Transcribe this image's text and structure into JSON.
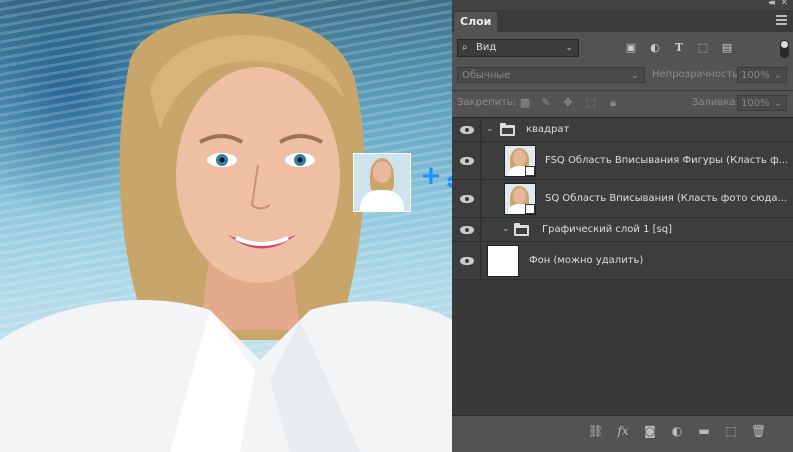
{
  "panel": {
    "tab_label": "Слои",
    "collapse_glyph": "◂◂",
    "close_glyph": "✕",
    "filter": {
      "search_glyph": "⌕",
      "label": "Вид"
    },
    "blend_mode": "Обычные",
    "opacity_label": "Непрозрачность:",
    "opacity_value": "100%",
    "lock_label": "Закрепить:",
    "fill_label": "Заливка:",
    "fill_value": "100%"
  },
  "layers": [
    {
      "name": "квадрат"
    },
    {
      "name": "FSQ Область Вписывания Фигуры (Класть ф..."
    },
    {
      "name": "SQ Область Вписывания (Класть фото сюда..."
    },
    {
      "name": "Графический слой 1 [sq]"
    },
    {
      "name": "Фон (можно удалить)"
    }
  ],
  "bottom_bar": {
    "fx_label": "fx"
  },
  "overlay": {
    "plus": "+",
    "accent_color": "#1e8dff"
  },
  "colors": {
    "panel": "#535353",
    "layers_bg": "#3a3a3a",
    "accent": "#1e8dff"
  }
}
